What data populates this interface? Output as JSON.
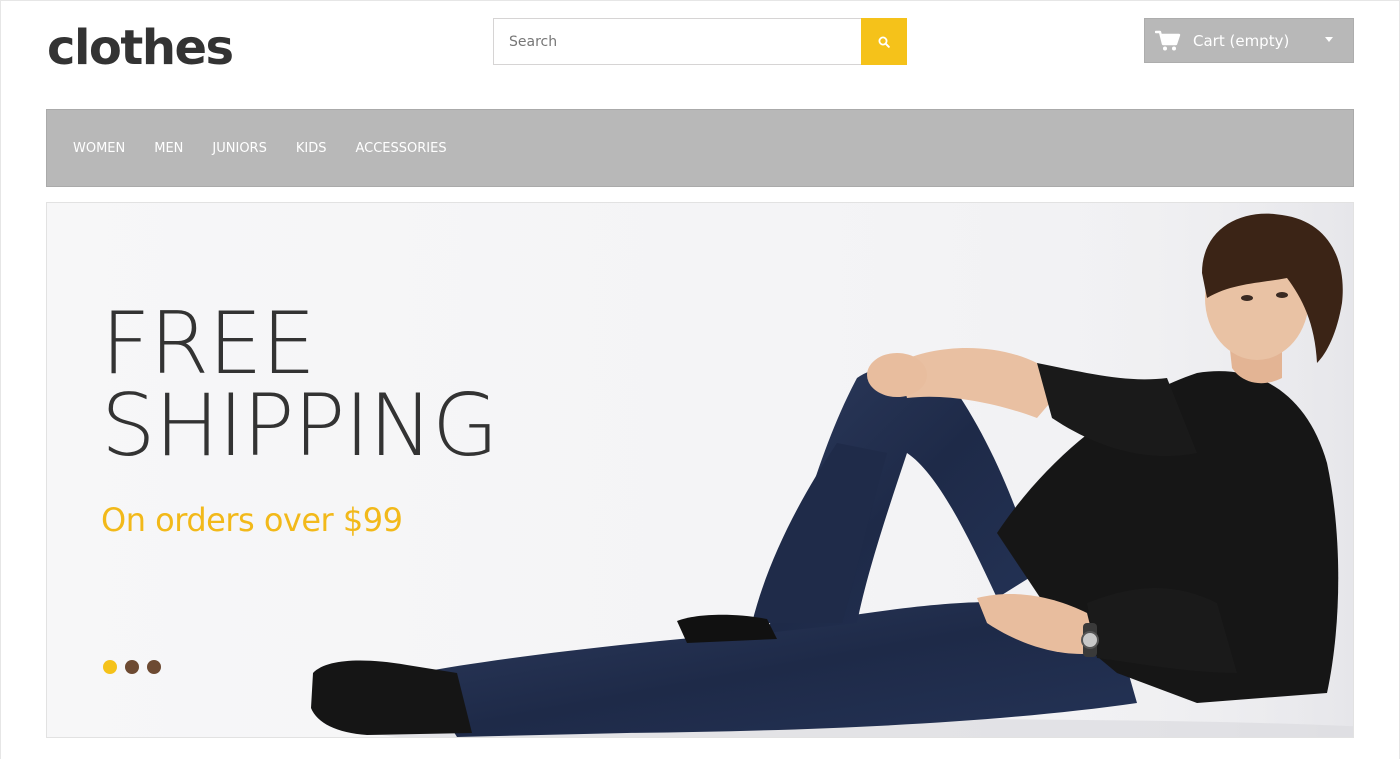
{
  "header": {
    "logo": "clothes",
    "search": {
      "placeholder": "Search",
      "value": "",
      "button_icon": "search-icon"
    },
    "cart": {
      "label": "Cart (empty)",
      "icon": "cart-icon"
    }
  },
  "nav": {
    "items": [
      {
        "label": "WOMEN"
      },
      {
        "label": "MEN"
      },
      {
        "label": "JUNIORS"
      },
      {
        "label": "KIDS"
      },
      {
        "label": "ACCESSORIES"
      }
    ]
  },
  "banner": {
    "title_line1": "FREE",
    "title_line2": "SHIPPING",
    "subtitle": "On orders over $99",
    "slide_count": 3,
    "active_slide": 1,
    "image": "man-in-jeans-reclining-photo"
  },
  "colors": {
    "accent": "#f5c21a",
    "nav_bg": "#b8b8b8",
    "text_dark": "#333333",
    "dot_inactive": "#6d4a32"
  }
}
